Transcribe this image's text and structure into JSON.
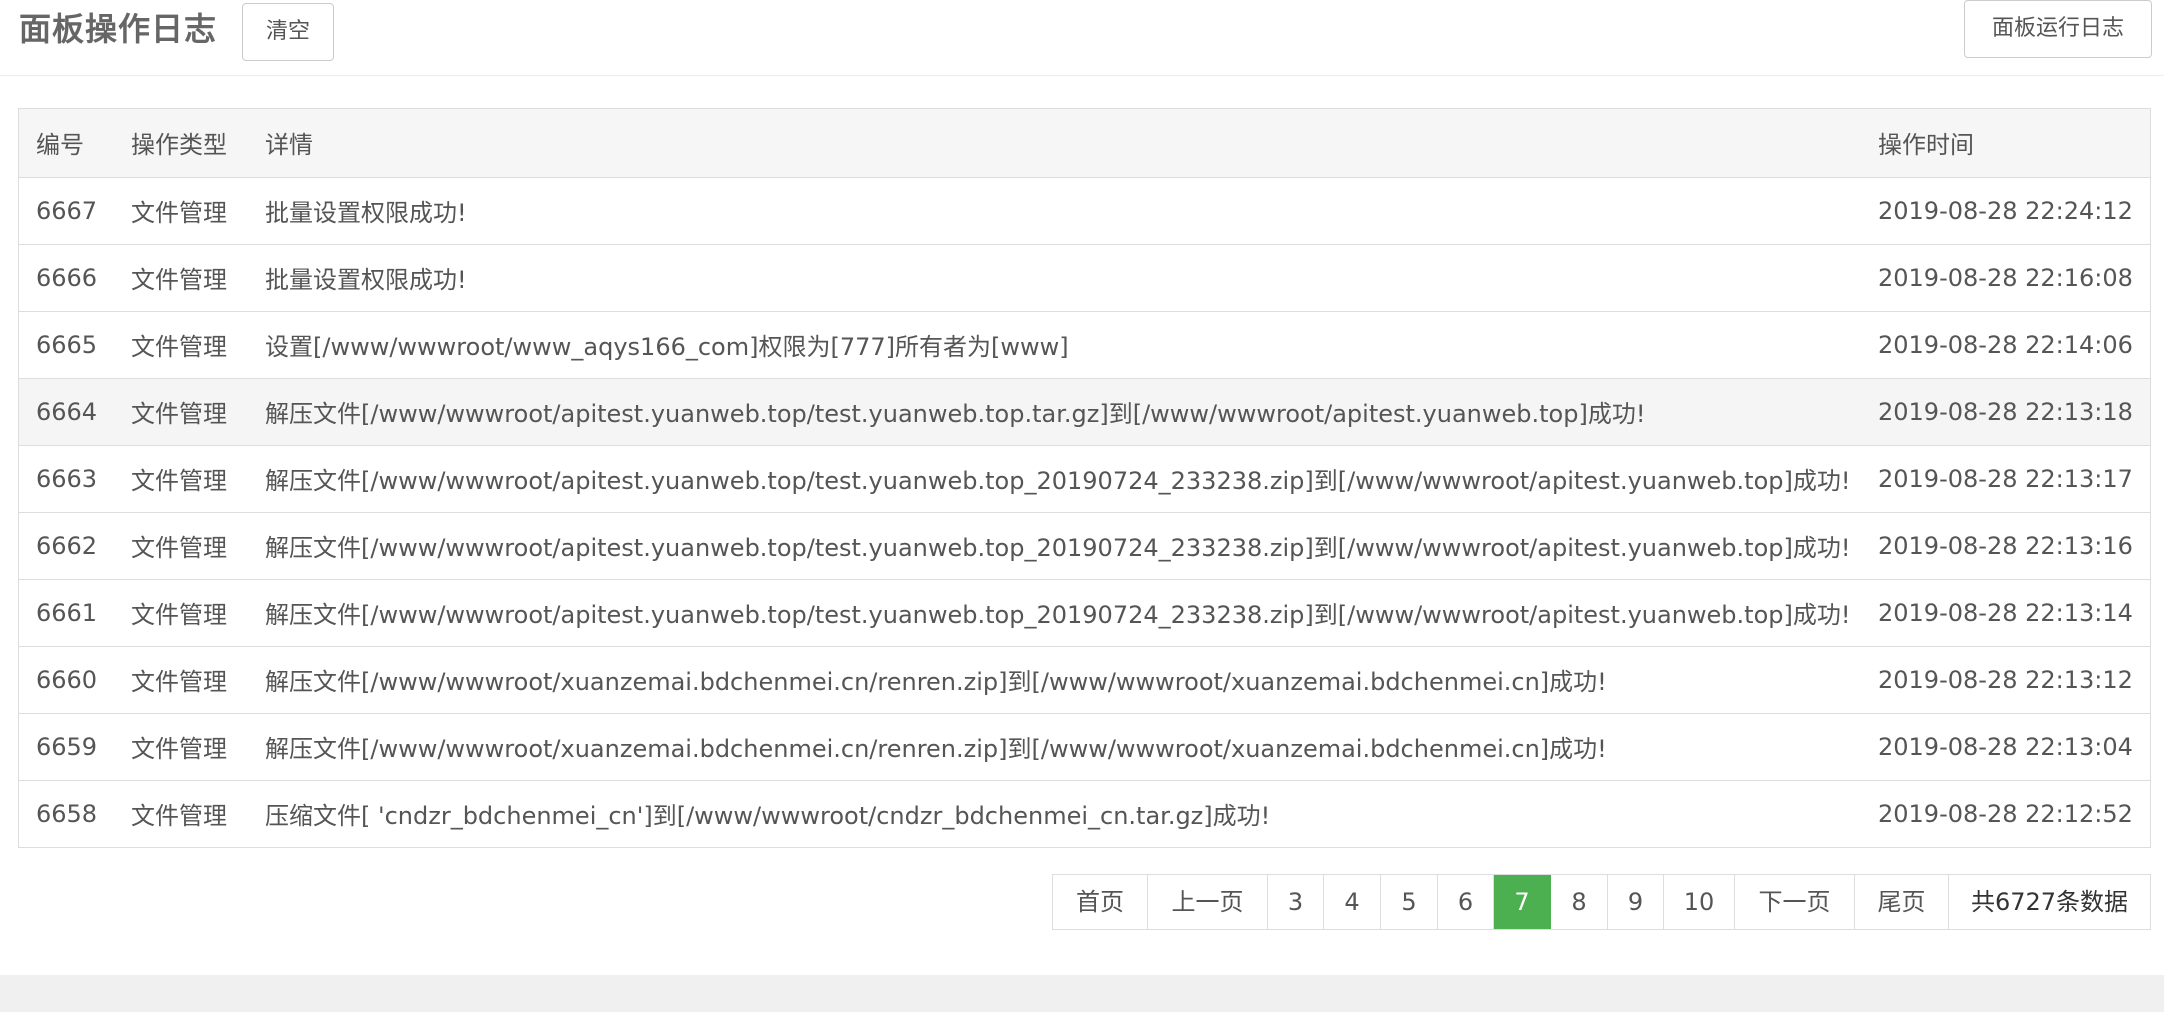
{
  "header": {
    "title": "面板操作日志",
    "clear_label": "清空",
    "run_log_label": "面板运行日志"
  },
  "table": {
    "columns": [
      "编号",
      "操作类型",
      "详情",
      "操作时间"
    ],
    "rows": [
      {
        "id": "6667",
        "type": "文件管理",
        "detail": "批量设置权限成功!",
        "time": "2019-08-28 22:24:12"
      },
      {
        "id": "6666",
        "type": "文件管理",
        "detail": "批量设置权限成功!",
        "time": "2019-08-28 22:16:08"
      },
      {
        "id": "6665",
        "type": "文件管理",
        "detail": "设置[/www/wwwroot/www_aqys166_com]权限为[777]所有者为[www]",
        "time": "2019-08-28 22:14:06"
      },
      {
        "id": "6664",
        "type": "文件管理",
        "detail": "解压文件[/www/wwwroot/apitest.yuanweb.top/test.yuanweb.top.tar.gz]到[/www/wwwroot/apitest.yuanweb.top]成功!",
        "time": "2019-08-28 22:13:18"
      },
      {
        "id": "6663",
        "type": "文件管理",
        "detail": "解压文件[/www/wwwroot/apitest.yuanweb.top/test.yuanweb.top_20190724_233238.zip]到[/www/wwwroot/apitest.yuanweb.top]成功!",
        "time": "2019-08-28 22:13:17"
      },
      {
        "id": "6662",
        "type": "文件管理",
        "detail": "解压文件[/www/wwwroot/apitest.yuanweb.top/test.yuanweb.top_20190724_233238.zip]到[/www/wwwroot/apitest.yuanweb.top]成功!",
        "time": "2019-08-28 22:13:16"
      },
      {
        "id": "6661",
        "type": "文件管理",
        "detail": "解压文件[/www/wwwroot/apitest.yuanweb.top/test.yuanweb.top_20190724_233238.zip]到[/www/wwwroot/apitest.yuanweb.top]成功!",
        "time": "2019-08-28 22:13:14"
      },
      {
        "id": "6660",
        "type": "文件管理",
        "detail": "解压文件[/www/wwwroot/xuanzemai.bdchenmei.cn/renren.zip]到[/www/wwwroot/xuanzemai.bdchenmei.cn]成功!",
        "time": "2019-08-28 22:13:12"
      },
      {
        "id": "6659",
        "type": "文件管理",
        "detail": "解压文件[/www/wwwroot/xuanzemai.bdchenmei.cn/renren.zip]到[/www/wwwroot/xuanzemai.bdchenmei.cn]成功!",
        "time": "2019-08-28 22:13:04"
      },
      {
        "id": "6658",
        "type": "文件管理",
        "detail": "压缩文件[ 'cndzr_bdchenmei_cn']到[/www/wwwroot/cndzr_bdchenmei_cn.tar.gz]成功!",
        "time": "2019-08-28 22:12:52"
      }
    ]
  },
  "pagination": {
    "first_label": "首页",
    "prev_label": "上一页",
    "pages": [
      "3",
      "4",
      "5",
      "6",
      "7",
      "8",
      "9",
      "10"
    ],
    "current_page": "7",
    "next_label": "下一页",
    "last_label": "尾页",
    "total_label": "共6727条数据",
    "active_color": "#4caf50"
  }
}
